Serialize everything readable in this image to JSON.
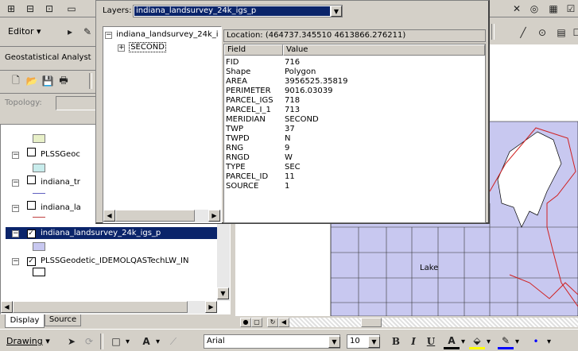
{
  "toolbar_top_left": {
    "icons": [
      "zoom-full-icon",
      "zoom-prev-icon",
      "zoom-next-icon",
      "select-features-icon"
    ]
  },
  "identify": {
    "layers_label": "Layers:",
    "layers_value": "indiana_landsurvey_24k_igs_p",
    "tree_root": "indiana_landsurvey_24k_i",
    "tree_child": "SECOND",
    "location": "Location: (464737.345510 4613866.276211)",
    "col_field": "Field",
    "col_value": "Value",
    "rows": [
      {
        "field": "FID",
        "value": "716"
      },
      {
        "field": "Shape",
        "value": "Polygon"
      },
      {
        "field": "AREA",
        "value": "3956525.35819"
      },
      {
        "field": "PERIMETER",
        "value": "9016.03039"
      },
      {
        "field": "PARCEL_IGS",
        "value": "718"
      },
      {
        "field": "PARCEL_I_1",
        "value": "713"
      },
      {
        "field": "MERIDIAN",
        "value": "SECOND"
      },
      {
        "field": "TWP",
        "value": "37"
      },
      {
        "field": "TWPD",
        "value": "N"
      },
      {
        "field": "RNG",
        "value": "9"
      },
      {
        "field": "RNGD",
        "value": "W"
      },
      {
        "field": "TYPE",
        "value": "SEC"
      },
      {
        "field": "PARCEL_ID",
        "value": "11"
      },
      {
        "field": "SOURCE",
        "value": "1"
      }
    ]
  },
  "left": {
    "editor_label": "Editor",
    "geostat_label": "Geostatistical Analyst",
    "topology_label": "Topology:",
    "toc": [
      {
        "label": "PLSSGeoc",
        "checked": false,
        "swatch": "#e8f0c8"
      },
      {
        "label": "indiana_tr",
        "checked": false,
        "swatch": "#c8ecec"
      },
      {
        "label": "indiana_la",
        "checked": false,
        "swatch": ""
      },
      {
        "label": "indiana_landsurvey_24k_igs_p",
        "checked": true,
        "swatch": "#c8c8f0"
      },
      {
        "label": "PLSSGeodetic_IDEMOLQASTechLW_IN",
        "checked": true,
        "swatch": "#ffffff"
      }
    ],
    "tab_display": "Display",
    "tab_source": "Source"
  },
  "map": {
    "place_label": "Lake",
    "fill": "#c8c8f0"
  },
  "drawing": {
    "drawing_label": "Drawing",
    "font_name": "Arial",
    "font_size": "10",
    "bold": "B",
    "italic": "I",
    "underline": "U",
    "text_icon": "A"
  }
}
